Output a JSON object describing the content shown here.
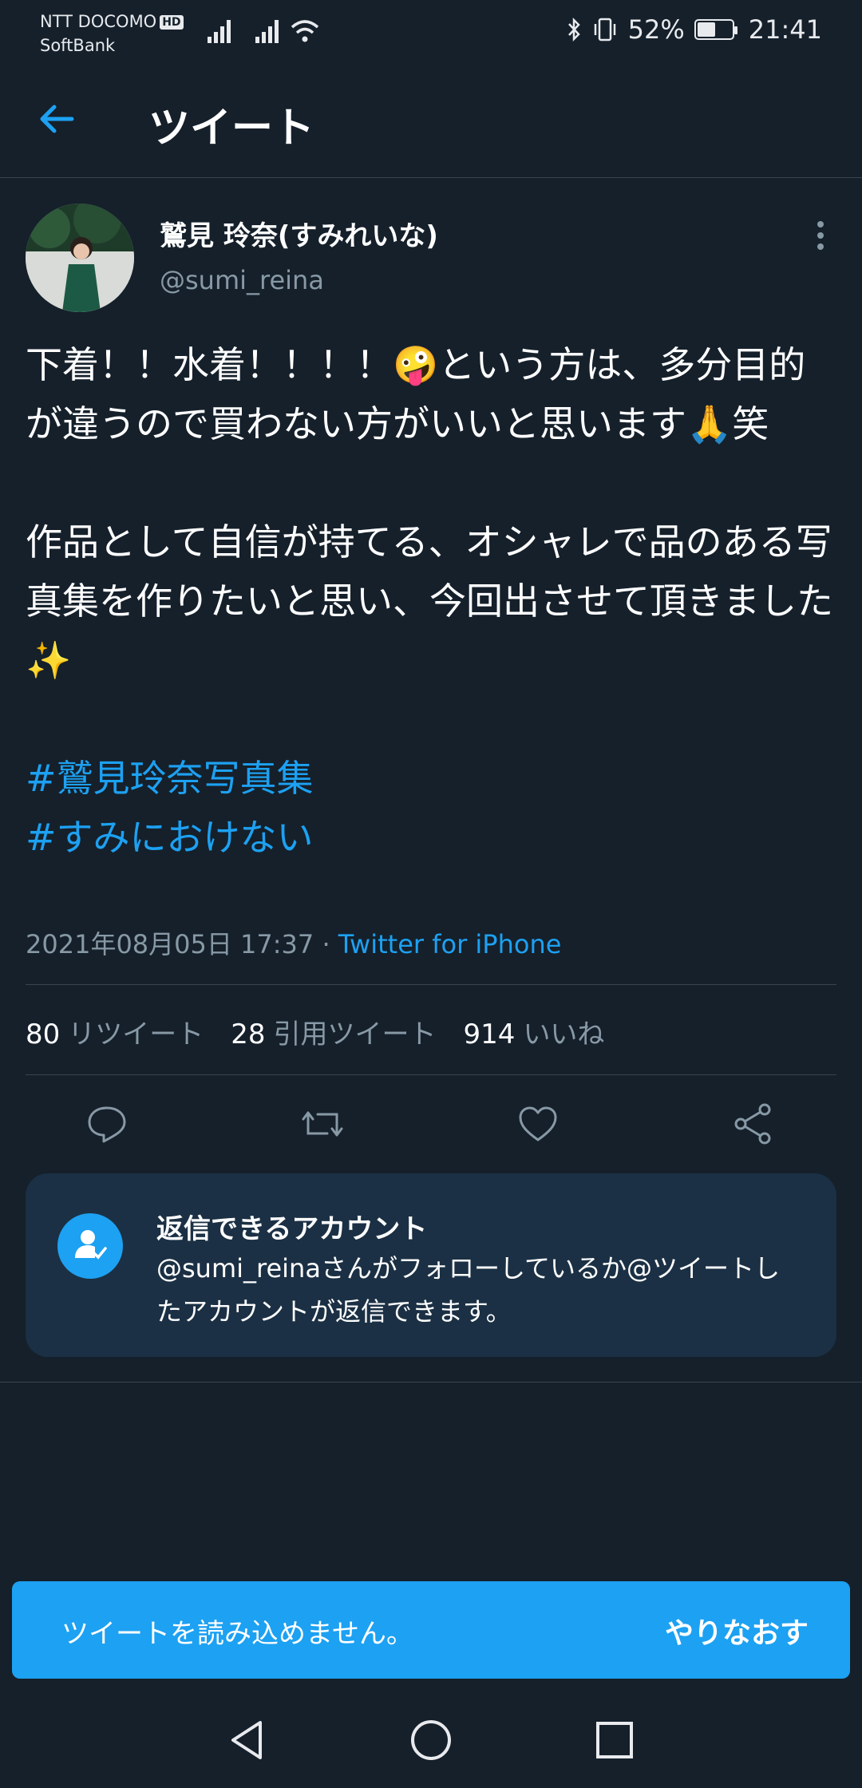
{
  "status_bar": {
    "carrier1": "NTT DOCOMO",
    "hd_badge": "HD",
    "carrier2": "SoftBank",
    "battery_percent": "52%",
    "battery_level": 0.52,
    "time": "21:41"
  },
  "header": {
    "title": "ツイート"
  },
  "tweet": {
    "author_name": "鷲見 玲奈(すみれいな)",
    "author_handle": "@sumi_reina",
    "text_p1": "下着！！水着！！！！🤪という方は、多分目的が違うので買わない方がいいと思います🙏笑",
    "text_p2": "作品として自信が持てる、オシャレで品のある写真集を作りたいと思い、今回出させて頂きました✨",
    "hashtag1": "#鷲見玲奈写真集",
    "hashtag2": "#すみにおけない",
    "timestamp": "2021年08月05日 17:37",
    "separator": " · ",
    "source": "Twitter for iPhone"
  },
  "stats": {
    "retweets_count": "80",
    "retweets_label": "リツイート",
    "quotes_count": "28",
    "quotes_label": "引用ツイート",
    "likes_count": "914",
    "likes_label": "いいね"
  },
  "reply_card": {
    "title": "返信できるアカウント",
    "body": "@sumi_reinaさんがフォローしているか@ツイートしたアカウントが返信できます。"
  },
  "snackbar": {
    "message": "ツイートを読み込めません。",
    "action": "やりなおす"
  },
  "colors": {
    "background": "#15202b",
    "accent": "#1da1f2",
    "secondary_text": "#8899a6",
    "card": "#1b3044"
  }
}
